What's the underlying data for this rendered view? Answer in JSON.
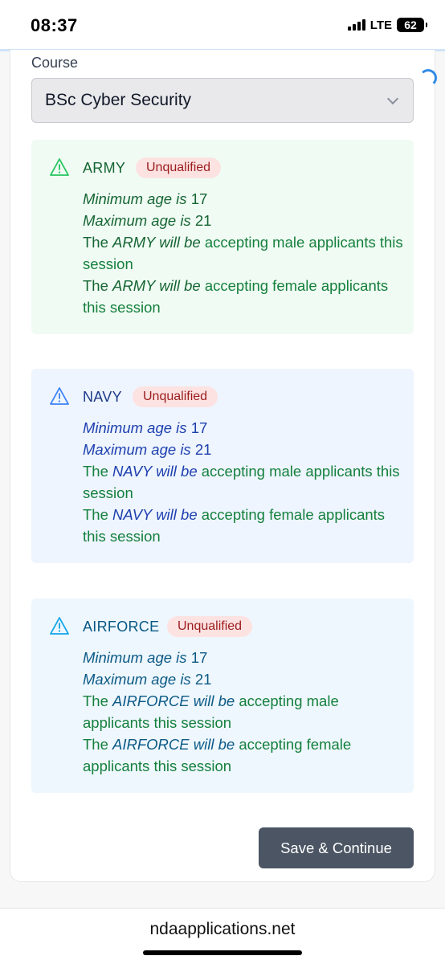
{
  "status": {
    "time": "08:37",
    "network": "LTE",
    "battery": "62"
  },
  "form": {
    "course_label": "Course",
    "course_value": "BSc Cyber Security",
    "save_label": "Save & Continue"
  },
  "panels": [
    {
      "title": "ARMY",
      "badge": "Unqualified",
      "min_prefix": "Minimum age is",
      "min_value": "17",
      "max_prefix": "Maximum age is",
      "max_value": "21",
      "the": "The",
      "branch_will_be": "ARMY will be",
      "male_text": "accepting male applicants this session",
      "female_text": "accepting female applicants this session"
    },
    {
      "title": "NAVY",
      "badge": "Unqualified",
      "min_prefix": "Minimum age is",
      "min_value": "17",
      "max_prefix": "Maximum age is",
      "max_value": "21",
      "the": "The",
      "branch_will_be": "NAVY will be",
      "male_text": "accepting male applicants this session",
      "female_text": "accepting female applicants this session"
    },
    {
      "title": "AIRFORCE",
      "badge": "Unqualified",
      "min_prefix": "Minimum age is",
      "min_value": "17",
      "max_prefix": "Maximum age is",
      "max_value": "21",
      "the": "The",
      "branch_will_be": "AIRFORCE will be",
      "male_text": "accepting male applicants this session",
      "female_text": "accepting female applicants this session"
    }
  ],
  "browser": {
    "url": "ndaapplications.net"
  },
  "colors": {
    "army_accent": "#166534",
    "navy_accent": "#1e3a8a",
    "airforce_accent": "#075985",
    "badge_bg": "#fde2e2",
    "badge_text": "#9b1c1c",
    "button_bg": "#4b5563"
  },
  "icons": [
    "warning-triangle-icon",
    "chevron-down-icon",
    "loading-spinner-icon",
    "signal-icon",
    "battery-icon"
  ]
}
